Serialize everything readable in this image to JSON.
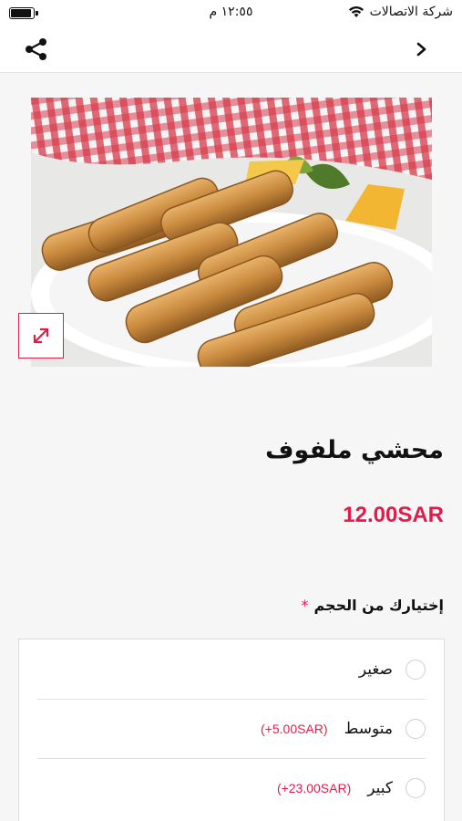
{
  "status_bar": {
    "carrier": "شركة الاتصالات",
    "time": "١٢:٥٥ م",
    "battery_level": 0.9
  },
  "nav": {
    "share_icon": "share-icon",
    "back_icon": "chevron-right-icon"
  },
  "product": {
    "image_description_icon": "product-image",
    "title": "محشي ملفوف",
    "price": "12.00SAR"
  },
  "options": {
    "label": "إختيارك من الحجم",
    "required_mark": "*",
    "items": [
      {
        "name": "صغير",
        "extra": ""
      },
      {
        "name": "متوسط",
        "extra": "(+5.00SAR)"
      },
      {
        "name": "كبير",
        "extra": "(+23.00SAR)"
      }
    ]
  },
  "colors": {
    "accent": "#e31b4a",
    "background": "#f6f6f6"
  }
}
